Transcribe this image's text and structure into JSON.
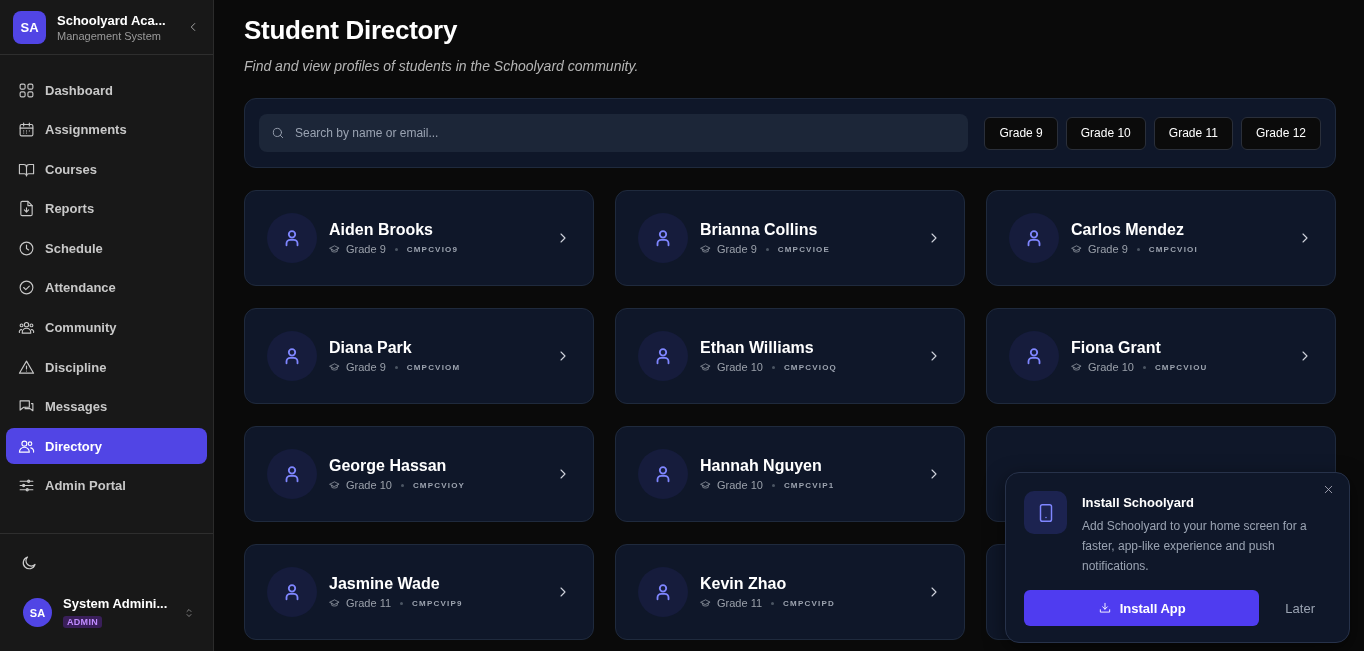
{
  "sidebar": {
    "brand": {
      "initials": "SA",
      "name": "Schoolyard Aca...",
      "subtitle": "Management System"
    },
    "items": [
      {
        "label": "Dashboard",
        "selected": false
      },
      {
        "label": "Assignments",
        "selected": false
      },
      {
        "label": "Courses",
        "selected": false
      },
      {
        "label": "Reports",
        "selected": false
      },
      {
        "label": "Schedule",
        "selected": false
      },
      {
        "label": "Attendance",
        "selected": false
      },
      {
        "label": "Community",
        "selected": false
      },
      {
        "label": "Discipline",
        "selected": false
      },
      {
        "label": "Messages",
        "selected": false
      },
      {
        "label": "Directory",
        "selected": true
      },
      {
        "label": "Admin Portal",
        "selected": false
      }
    ],
    "user": {
      "initials": "SA",
      "name": "System Admini...",
      "role": "ADMIN"
    }
  },
  "page": {
    "title": "Student Directory",
    "subtitle": "Find and view profiles of students in the Schoolyard community."
  },
  "search": {
    "placeholder": "Search by name or email..."
  },
  "filters": [
    "Grade 9",
    "Grade 10",
    "Grade 11",
    "Grade 12"
  ],
  "students": [
    {
      "kind": "student",
      "name": "Aiden Brooks",
      "grade": "Grade 9",
      "id": "CMPCVIO9"
    },
    {
      "kind": "student",
      "name": "Brianna Collins",
      "grade": "Grade 9",
      "id": "CMPCVIOE"
    },
    {
      "kind": "student",
      "name": "Carlos Mendez",
      "grade": "Grade 9",
      "id": "CMPCVIOI"
    },
    {
      "kind": "student",
      "name": "Diana Park",
      "grade": "Grade 9",
      "id": "CMPCVIOM"
    },
    {
      "kind": "student",
      "name": "Ethan Williams",
      "grade": "Grade 10",
      "id": "CMPCVIOQ"
    },
    {
      "kind": "student",
      "name": "Fiona Grant",
      "grade": "Grade 10",
      "id": "CMPCVIOU"
    },
    {
      "kind": "student",
      "name": "George Hassan",
      "grade": "Grade 10",
      "id": "CMPCVIOY"
    },
    {
      "kind": "student",
      "name": "Hannah Nguyen",
      "grade": "Grade 10",
      "id": "CMPCVIP1"
    },
    {
      "kind": "covered"
    },
    {
      "kind": "student",
      "name": "Jasmine Wade",
      "grade": "Grade 11",
      "id": "CMPCVIP9"
    },
    {
      "kind": "student",
      "name": "Kevin Zhao",
      "grade": "Grade 11",
      "id": "CMPCVIPD"
    },
    {
      "kind": "covered"
    }
  ],
  "install_prompt": {
    "title": "Install Schoolyard",
    "text": "Add Schoolyard to your home screen for a faster, app-like experience and push notifications.",
    "install_button": "Install App",
    "later_button": "Later"
  }
}
